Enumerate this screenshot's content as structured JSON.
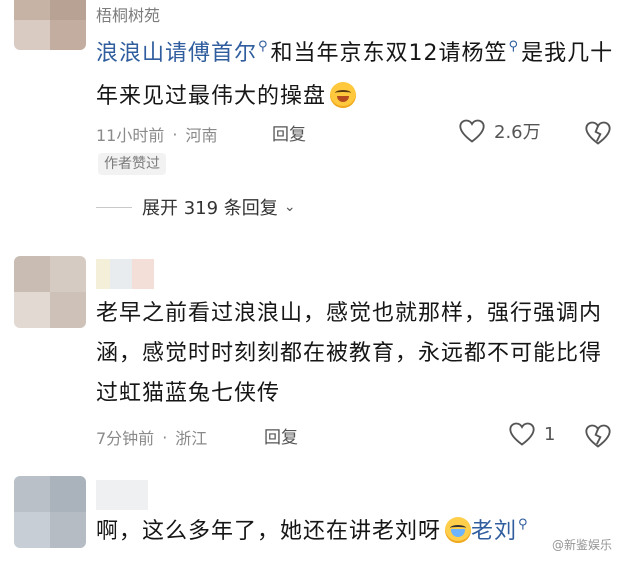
{
  "comments": [
    {
      "username": "梧桐树苑",
      "text_parts": [
        "浪浪山请傅首尔",
        "和当年京东双12请杨笠",
        "是我几十年来见过最伟大的操盘"
      ],
      "time": "11小时前",
      "location": "河南",
      "reply_label": "回复",
      "like_count": "2.6万",
      "author_tag": "作者赞过",
      "expand_label": "展开 319 条回复"
    },
    {
      "text": "老早之前看过浪浪山，感觉也就那样，强行强调内涵，感觉时时刻刻都在被教育，永远都不可能比得过虹猫蓝兔七侠传",
      "time": "7分钟前",
      "location": "浙江",
      "reply_label": "回复",
      "like_count": "1"
    },
    {
      "text": "啊，这么多年了，她还在讲老刘呀",
      "link": "老刘"
    }
  ],
  "watermark": "@新鉴娱乐",
  "icons": [
    "search-icon",
    "smile-emoji",
    "heart-icon",
    "dislike-icon",
    "chevron-down-icon",
    "cry-laugh-emoji"
  ],
  "colors": {
    "link": "#2f5d9e",
    "meta": "#8a8a8a",
    "text": "#161616"
  }
}
